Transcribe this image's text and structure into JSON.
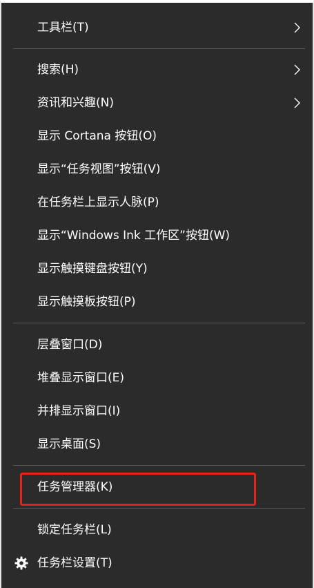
{
  "menu": {
    "items": [
      {
        "label": "工具栏(T)",
        "has_submenu": true
      },
      {
        "label": "搜索(H)",
        "has_submenu": true
      },
      {
        "label": "资讯和兴趣(N)",
        "has_submenu": true
      },
      {
        "label": "显示 Cortana 按钮(O)"
      },
      {
        "label": "显示“任务视图”按钮(V)"
      },
      {
        "label": "在任务栏上显示人脉(P)"
      },
      {
        "label": "显示“Windows Ink 工作区”按钮(W)"
      },
      {
        "label": "显示触摸键盘按钮(Y)"
      },
      {
        "label": "显示触摸板按钮(P)"
      },
      {
        "label": "层叠窗口(D)"
      },
      {
        "label": "堆叠显示窗口(E)"
      },
      {
        "label": "并排显示窗口(I)"
      },
      {
        "label": "显示桌面(S)"
      },
      {
        "label": "任务管理器(K)",
        "highlighted": true
      },
      {
        "label": "锁定任务栏(L)"
      },
      {
        "label": "任务栏设置(T)",
        "icon": "gear-icon"
      }
    ]
  },
  "colors": {
    "menu_background": "#2b2b2b",
    "text": "#ffffff",
    "separator": "#5a5a5a",
    "highlight_border": "#e4231a"
  }
}
